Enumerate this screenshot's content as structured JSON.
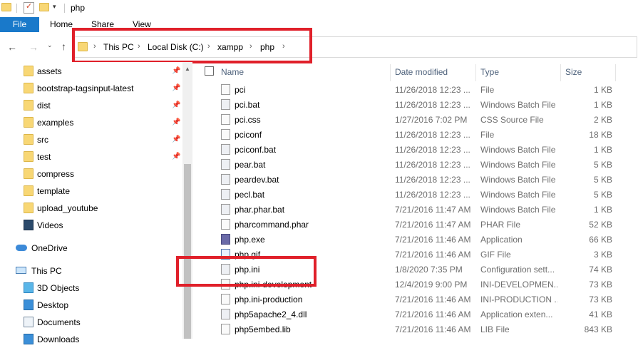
{
  "window": {
    "title": "php"
  },
  "ribbon": {
    "tabs": [
      "File",
      "Home",
      "Share",
      "View"
    ]
  },
  "address": {
    "crumbs": [
      "This PC",
      "Local Disk (C:)",
      "xampp",
      "php"
    ]
  },
  "nav": {
    "quick_access": [
      {
        "label": "assets",
        "pinned": true
      },
      {
        "label": "bootstrap-tagsinput-latest",
        "pinned": true
      },
      {
        "label": "dist",
        "pinned": true
      },
      {
        "label": "examples",
        "pinned": true
      },
      {
        "label": "src",
        "pinned": true
      },
      {
        "label": "test",
        "pinned": true
      },
      {
        "label": "compress",
        "pinned": false
      },
      {
        "label": "template",
        "pinned": false
      },
      {
        "label": "upload_youtube",
        "pinned": false
      },
      {
        "label": "Videos",
        "pinned": false
      }
    ],
    "onedrive": "OneDrive",
    "this_pc": "This PC",
    "pc_items": [
      "3D Objects",
      "Desktop",
      "Documents",
      "Downloads"
    ]
  },
  "columns": {
    "name": "Name",
    "date": "Date modified",
    "type": "Type",
    "size": "Size"
  },
  "files": [
    {
      "name": "pci",
      "date": "11/26/2018 12:23 ...",
      "type": "File",
      "size": "1 KB"
    },
    {
      "name": "pci.bat",
      "date": "11/26/2018 12:23 ...",
      "type": "Windows Batch File",
      "size": "1 KB"
    },
    {
      "name": "pci.css",
      "date": "1/27/2016 7:02 PM",
      "type": "CSS Source File",
      "size": "2 KB"
    },
    {
      "name": "pciconf",
      "date": "11/26/2018 12:23 ...",
      "type": "File",
      "size": "18 KB"
    },
    {
      "name": "pciconf.bat",
      "date": "11/26/2018 12:23 ...",
      "type": "Windows Batch File",
      "size": "1 KB"
    },
    {
      "name": "pear.bat",
      "date": "11/26/2018 12:23 ...",
      "type": "Windows Batch File",
      "size": "5 KB"
    },
    {
      "name": "peardev.bat",
      "date": "11/26/2018 12:23 ...",
      "type": "Windows Batch File",
      "size": "5 KB"
    },
    {
      "name": "pecl.bat",
      "date": "11/26/2018 12:23 ...",
      "type": "Windows Batch File",
      "size": "5 KB"
    },
    {
      "name": "phar.phar.bat",
      "date": "7/21/2016 11:47 AM",
      "type": "Windows Batch File",
      "size": "1 KB"
    },
    {
      "name": "pharcommand.phar",
      "date": "7/21/2016 11:47 AM",
      "type": "PHAR File",
      "size": "52 KB"
    },
    {
      "name": "php.exe",
      "date": "7/21/2016 11:46 AM",
      "type": "Application",
      "size": "66 KB"
    },
    {
      "name": "php.gif",
      "date": "7/21/2016 11:46 AM",
      "type": "GIF File",
      "size": "3 KB"
    },
    {
      "name": "php.ini",
      "date": "1/8/2020 7:35 PM",
      "type": "Configuration sett...",
      "size": "74 KB"
    },
    {
      "name": "php.ini-development",
      "date": "12/4/2019 9:00 PM",
      "type": "INI-DEVELOPMEN...",
      "size": "73 KB"
    },
    {
      "name": "php.ini-production",
      "date": "7/21/2016 11:46 AM",
      "type": "INI-PRODUCTION ...",
      "size": "73 KB"
    },
    {
      "name": "php5apache2_4.dll",
      "date": "7/21/2016 11:46 AM",
      "type": "Application exten...",
      "size": "41 KB"
    },
    {
      "name": "php5embed.lib",
      "date": "7/21/2016 11:46 AM",
      "type": "LIB File",
      "size": "843 KB"
    }
  ],
  "colors": {
    "accent": "#1979ca",
    "highlight": "#e0202a",
    "folder": "#f8d775"
  }
}
